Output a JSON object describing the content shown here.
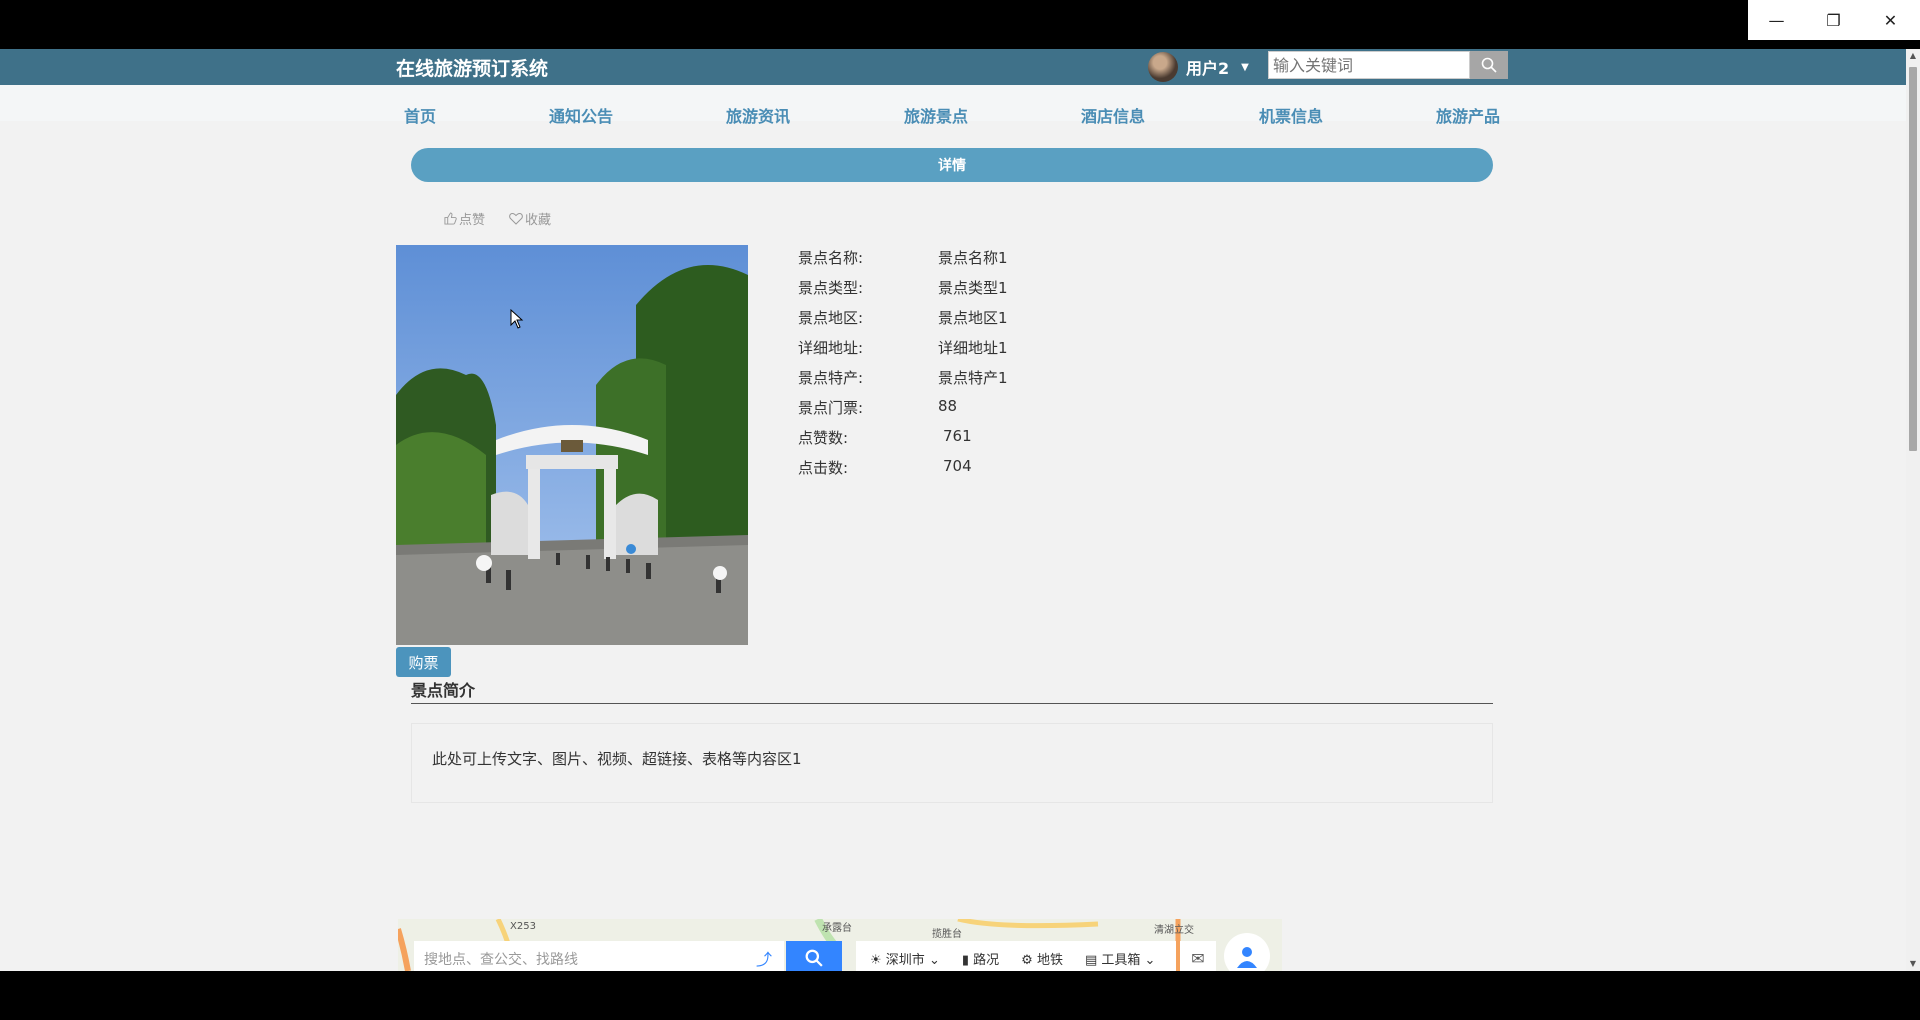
{
  "header": {
    "site_title": "在线旅游预订系统",
    "user_name": "用户2",
    "search_placeholder": "输入关键词"
  },
  "nav": {
    "items": [
      "首页",
      "通知公告",
      "旅游资讯",
      "旅游景点",
      "酒店信息",
      "机票信息",
      "旅游产品"
    ]
  },
  "detail": {
    "bar_label": "详情",
    "like_label": "点赞",
    "favorite_label": "收藏",
    "buy_label": "购票",
    "fields": [
      {
        "label": "景点名称:",
        "value": "景点名称1"
      },
      {
        "label": "景点类型:",
        "value": "景点类型1"
      },
      {
        "label": "景点地区:",
        "value": "景点地区1"
      },
      {
        "label": "详细地址:",
        "value": "详细地址1"
      },
      {
        "label": "景点特产:",
        "value": "景点特产1"
      },
      {
        "label": "景点门票:",
        "value": "88"
      },
      {
        "label": "点赞数:",
        "value": "761"
      },
      {
        "label": "点击数:",
        "value": "704"
      }
    ]
  },
  "intro": {
    "title": "景点简介",
    "content": "此处可上传文字、图片、视频、超链接、表格等内容区1"
  },
  "map": {
    "search_placeholder": "搜地点、查公交、找路线",
    "city": "深圳市",
    "traffic": "路况",
    "subway": "地铁",
    "toolbox": "工具箱",
    "labels": [
      "X253",
      "承露台",
      "揽胜台",
      "清湖立交"
    ]
  }
}
